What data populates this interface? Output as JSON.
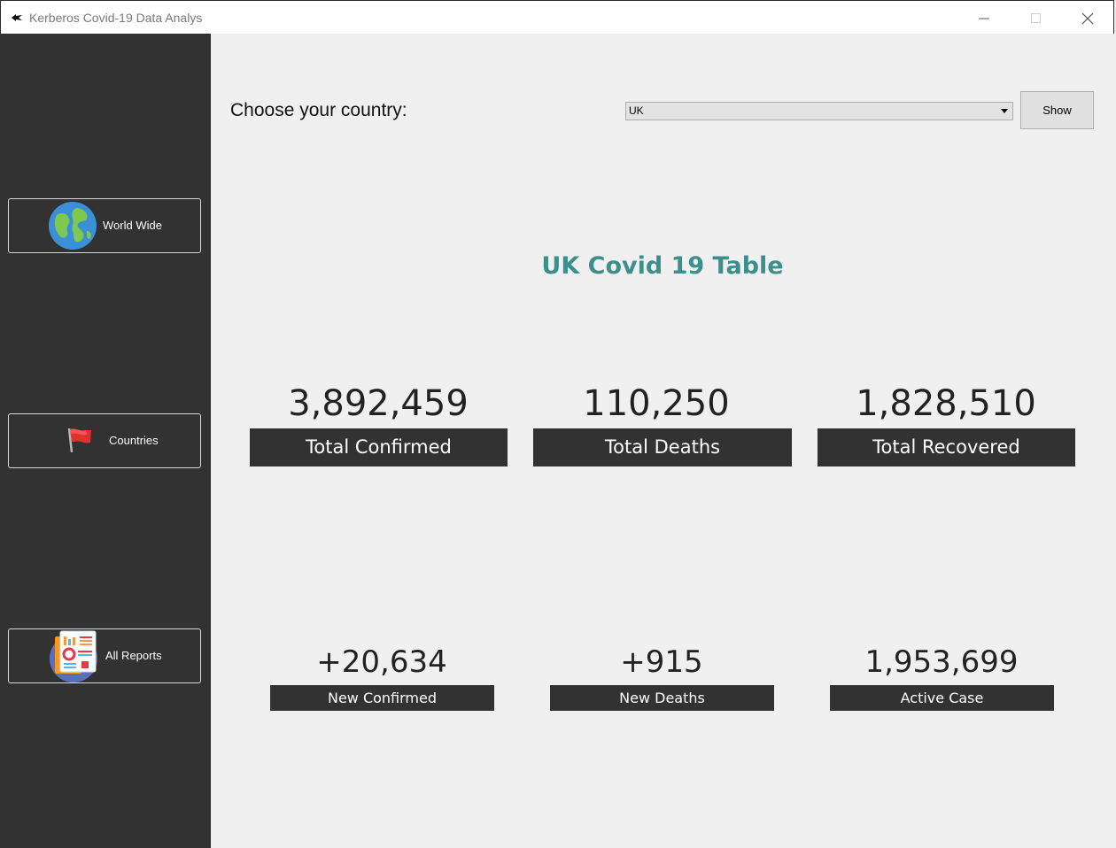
{
  "window": {
    "title": "Kerberos Covid-19 Data Analys",
    "icon": "app-logo-icon"
  },
  "sidebar": {
    "items": [
      {
        "label": "World Wide",
        "icon": "globe-icon"
      },
      {
        "label": "Countries",
        "icon": "flag-icon"
      },
      {
        "label": "All Reports",
        "icon": "report-icon"
      }
    ]
  },
  "main": {
    "choose_label": "Choose your country:",
    "country_select": {
      "value": "UK"
    },
    "show_button": "Show",
    "table_title": "UK Covid 19 Table",
    "stats_top": [
      {
        "value": "3,892,459",
        "label": "Total Confirmed"
      },
      {
        "value": "110,250",
        "label": "Total Deaths"
      },
      {
        "value": "1,828,510",
        "label": "Total Recovered"
      }
    ],
    "stats_bottom": [
      {
        "value": "+20,634",
        "label": "New Confirmed"
      },
      {
        "value": "+915",
        "label": "New Deaths"
      },
      {
        "value": "1,953,699",
        "label": "Active Case"
      }
    ]
  },
  "colors": {
    "sidebar_bg": "#323232",
    "main_bg": "#f0f0f0",
    "title_accent": "#3d8f8b",
    "label_bg": "#323232"
  }
}
